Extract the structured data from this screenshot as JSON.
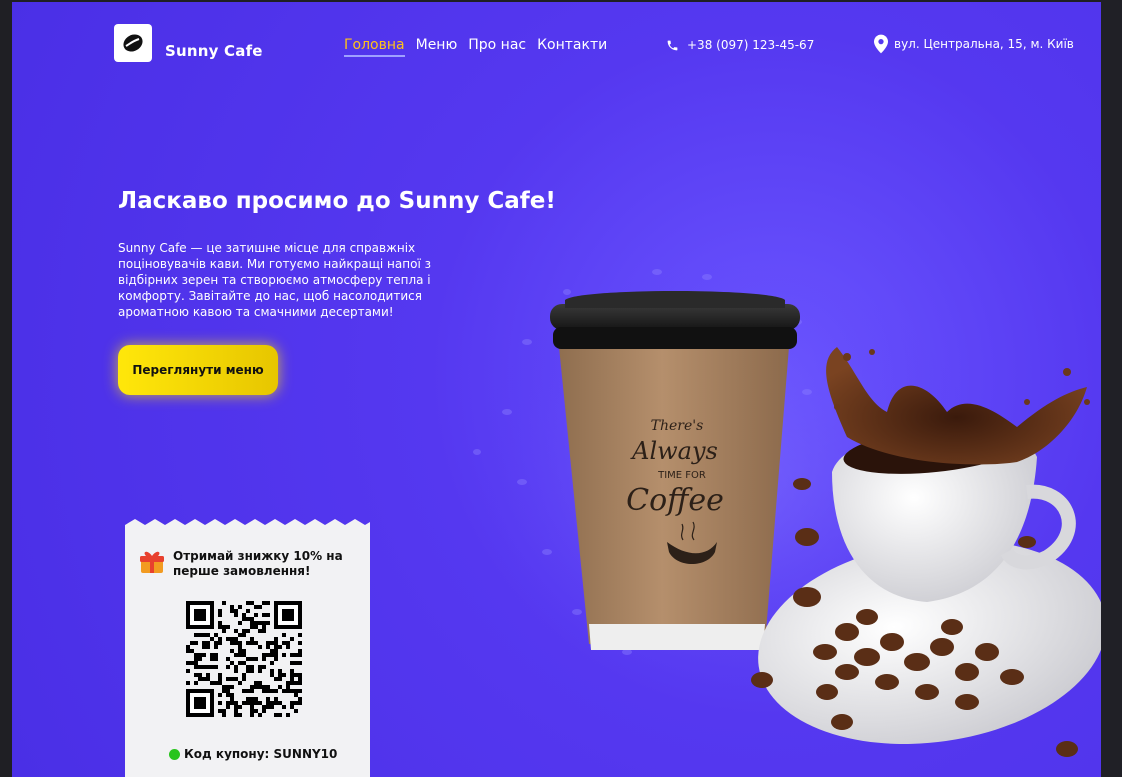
{
  "brand": {
    "name": "Sunny Cafe"
  },
  "nav": {
    "items": [
      {
        "label": "Головна",
        "active": true
      },
      {
        "label": "Меню",
        "active": false
      },
      {
        "label": "Про нас",
        "active": false
      },
      {
        "label": "Контакти",
        "active": false
      }
    ]
  },
  "contact": {
    "phone": "+38 (097) 123-45-67",
    "address": "вул. Центральна, 15, м. Київ"
  },
  "hero": {
    "title": "Ласкаво просимо до Sunny Cafe!",
    "text": "Sunny Cafe — це затишне місце для справжніх поціновувачів кави. Ми готуємо найкращі напої з відбірних зерен та створюємо атмосферу тепла і комфорту. Завітайте до нас, щоб насолодитися ароматною кавою та смачними десертами!",
    "cta_label": "Переглянути меню"
  },
  "coupon": {
    "title": "Отримай знижку 10% на перше замовлення!",
    "code_label": "Код купону: SUNNY10"
  },
  "cup_print": {
    "line1": "There's",
    "line2": "Always",
    "line3": "TIME FOR",
    "line4": "Coffee"
  },
  "colors": {
    "background": "#5538f0",
    "accent_yellow": "#ffe70a",
    "active_nav": "#ffc21a",
    "coupon_bg": "#f2f2f4"
  }
}
